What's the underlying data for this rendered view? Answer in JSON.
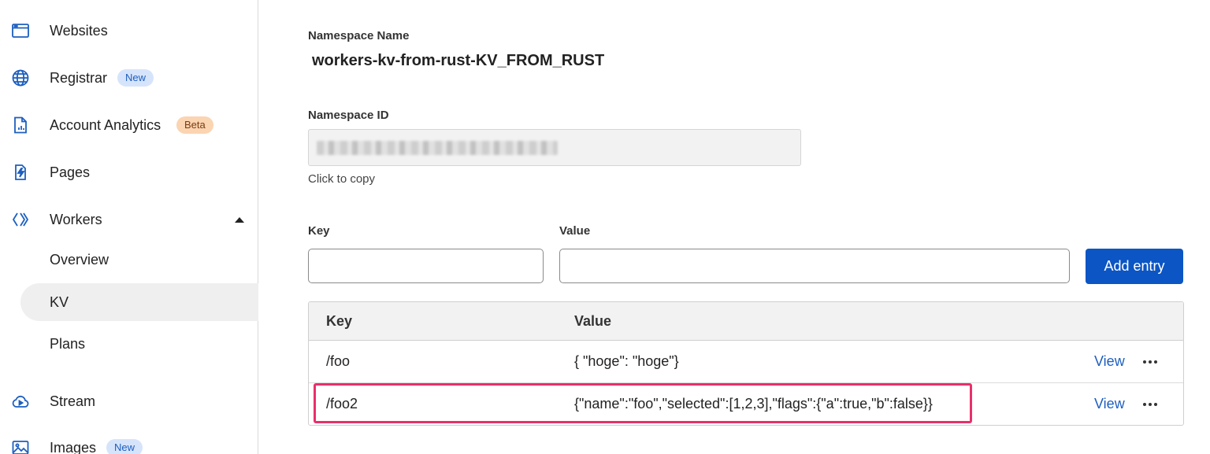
{
  "sidebar": {
    "items": [
      {
        "label": "Websites",
        "icon": "browser-window-icon"
      },
      {
        "label": "Registrar",
        "icon": "globe-icon",
        "badge": "New"
      },
      {
        "label": "Account Analytics",
        "icon": "analytics-document-icon",
        "badge": "Beta"
      },
      {
        "label": "Pages",
        "icon": "pages-bolt-icon"
      },
      {
        "label": "Workers",
        "icon": "workers-icon",
        "expanded": true
      },
      {
        "label": "Stream",
        "icon": "cloud-play-icon"
      },
      {
        "label": "Images",
        "icon": "image-icon",
        "badge": "New"
      }
    ],
    "workers_subitems": [
      {
        "label": "Overview"
      },
      {
        "label": "KV",
        "active": true
      },
      {
        "label": "Plans"
      }
    ]
  },
  "namespace": {
    "name_label": "Namespace Name",
    "name": "workers-kv-from-rust-KV_FROM_RUST",
    "id_label": "Namespace ID",
    "copy_hint": "Click to copy"
  },
  "entry_form": {
    "key_label": "Key",
    "value_label": "Value",
    "key_value": "",
    "value_value": "",
    "add_button": "Add entry"
  },
  "table": {
    "headers": [
      "Key",
      "Value"
    ],
    "rows": [
      {
        "key": "/foo",
        "value": "{ \"hoge\": \"hoge\"}",
        "action": "View"
      },
      {
        "key": "/foo2",
        "value": "{\"name\":\"foo\",\"selected\":[1,2,3],\"flags\":{\"a\":true,\"b\":false}}",
        "action": "View"
      }
    ]
  },
  "colors": {
    "accent": "#0b55c4",
    "highlight": "#ea2f6b",
    "badge_new_bg": "#d6e4fb",
    "badge_beta_bg": "#fbd4b2"
  }
}
